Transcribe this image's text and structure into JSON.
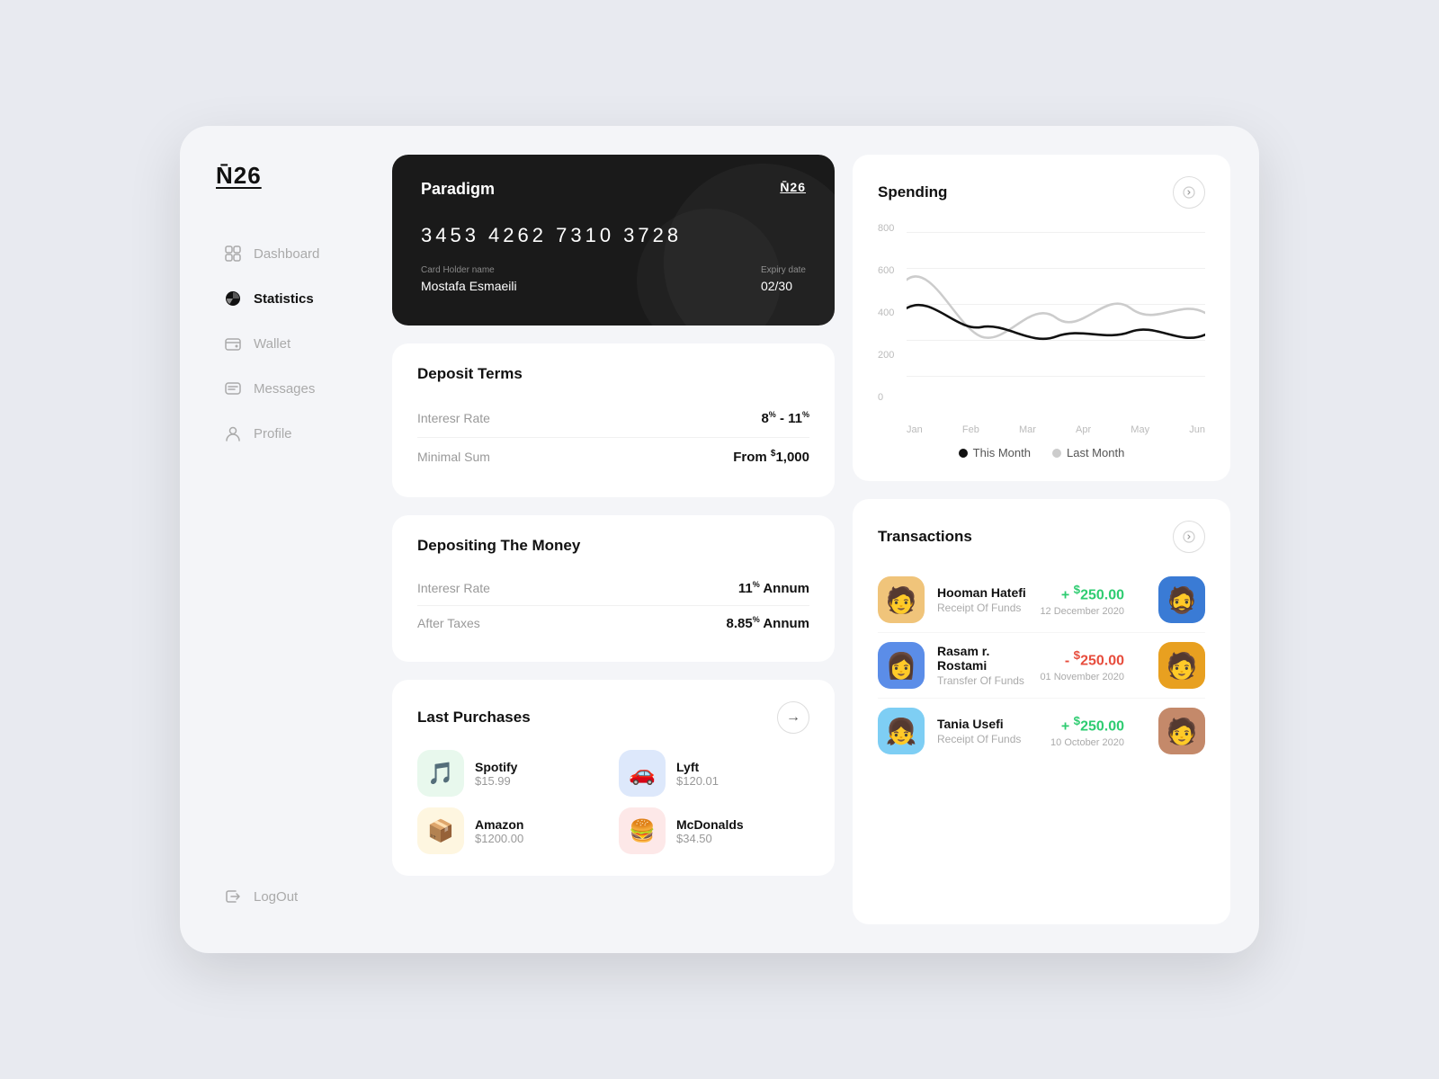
{
  "logo": "N̄26",
  "sidebar": {
    "items": [
      {
        "id": "dashboard",
        "label": "Dashboard",
        "active": false
      },
      {
        "id": "statistics",
        "label": "Statistics",
        "active": true
      },
      {
        "id": "wallet",
        "label": "Wallet",
        "active": false
      },
      {
        "id": "messages",
        "label": "Messages",
        "active": false
      },
      {
        "id": "profile",
        "label": "Profile",
        "active": false
      }
    ],
    "logout_label": "LogOut"
  },
  "card": {
    "brand": "Paradigm",
    "logo": "N̄26",
    "number": "3453 4262 7310 3728",
    "holder_label": "Card Holder name",
    "holder_name": "Mostafa Esmaeili",
    "expiry_label": "Expiry date",
    "expiry": "02/30"
  },
  "deposit_terms": {
    "title": "Deposit Terms",
    "rows": [
      {
        "label": "Interesr Rate",
        "value": "8% - 11%"
      },
      {
        "label": "Minimal Sum",
        "value": "From $1,000"
      }
    ]
  },
  "depositing": {
    "title": "Depositing The Money",
    "rows": [
      {
        "label": "Interesr Rate",
        "value": "11% Annum"
      },
      {
        "label": "After Taxes",
        "value": "8.85% Annum"
      }
    ]
  },
  "purchases": {
    "title": "Last Purchases",
    "items": [
      {
        "name": "Spotify",
        "amount": "$15.99",
        "color": "#1db954",
        "bg": "#e8f8ed",
        "icon": "🎵"
      },
      {
        "name": "Lyft",
        "amount": "$120.01",
        "color": "#ea0099",
        "bg": "#e8f0fd",
        "icon": "🚗"
      },
      {
        "name": "Amazon",
        "amount": "$1200.00",
        "color": "#ff9900",
        "bg": "#fef9e7",
        "icon": "📦"
      },
      {
        "name": "McDonalds",
        "amount": "$34.50",
        "color": "#ff0000",
        "bg": "#fde8e8",
        "icon": "🍔"
      }
    ]
  },
  "spending": {
    "title": "Spending",
    "y_labels": [
      "800",
      "600",
      "400",
      "200",
      "0"
    ],
    "x_labels": [
      "Jan",
      "Feb",
      "Mar",
      "Apr",
      "May",
      "Jun"
    ],
    "legend": {
      "this_month": "This Month",
      "last_month": "Last Month"
    }
  },
  "transactions": {
    "title": "Transactions",
    "items": [
      {
        "name": "Hooman Hatefi",
        "desc": "Receipt Of Funds",
        "date": "12 December 2020",
        "amount": "+$250.00",
        "type": "positive",
        "avatar_color": "#f0c090",
        "avatar_icon": "👨"
      },
      {
        "name": "Rasam r. Rostami",
        "desc": "Transfer Of Funds",
        "date": "01 November 2020",
        "amount": "-$250.00",
        "type": "negative",
        "avatar_color": "#5588ee",
        "avatar_icon": "👩"
      },
      {
        "name": "Tania Usefi",
        "desc": "Receipt Of Funds",
        "date": "10 October 2020",
        "amount": "+$250.00",
        "type": "positive",
        "avatar_color": "#88ccee",
        "avatar_icon": "👧"
      }
    ]
  }
}
